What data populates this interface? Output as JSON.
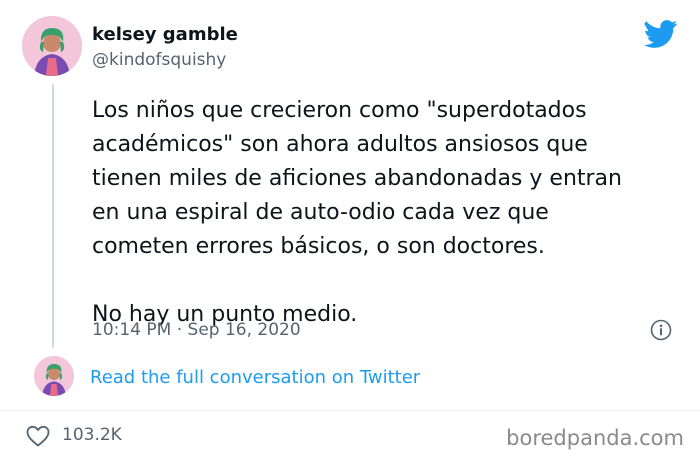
{
  "tweet": {
    "author": {
      "name": "kelsey gamble",
      "handle": "@kindofsquishy",
      "avatar_icon": "avatar-icon"
    },
    "brand_icon": "twitter-bird-icon",
    "text": "Los niños que crecieron como \"superdotados\nacadémicos\" son ahora adultos ansiosos que\ntienen miles de aficiones abandonadas y entran\nen una espiral de auto-odio cada vez que\ncometen errores básicos, o son doctores.\n\nNo hay un punto medio.",
    "timestamp": "10:14 PM · Sep 16, 2020",
    "info_icon": "info-icon",
    "read_link_label": "Read the full conversation on Twitter",
    "like_icon": "heart-icon",
    "like_count": "103.2K"
  },
  "watermark": "boredpanda.com",
  "colors": {
    "link": "#1d9bf0",
    "twitter_blue": "#1d9bf0",
    "secondary_text": "#536471",
    "text": "#0f1419"
  }
}
